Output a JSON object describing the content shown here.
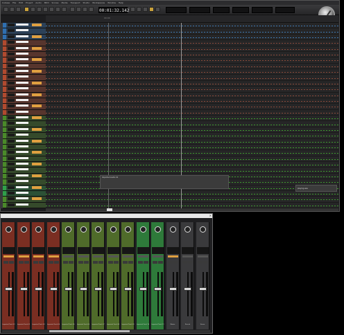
{
  "app": {
    "menu": [
      "Cubase",
      "File",
      "Edit",
      "Project",
      "Audio",
      "MIDI",
      "Scores",
      "Media",
      "Transport",
      "Studio",
      "Workspaces",
      "Window",
      "Help"
    ]
  },
  "transport": {
    "time": "00:01:32.142",
    "time_sub": ""
  },
  "ruler": {
    "marker": "00:00"
  },
  "tracks": [
    {
      "color": "#2f6fb0"
    },
    {
      "color": "#2f6fb0"
    },
    {
      "color": "#2f6fb0"
    },
    {
      "color": "#b04a2f"
    },
    {
      "color": "#b04a2f"
    },
    {
      "color": "#b04a2f"
    },
    {
      "color": "#b04a2f"
    },
    {
      "color": "#b04a2f"
    },
    {
      "color": "#b04a2f"
    },
    {
      "color": "#b04a2f"
    },
    {
      "color": "#b04a2f"
    },
    {
      "color": "#b04a2f"
    },
    {
      "color": "#b04a2f"
    },
    {
      "color": "#b04a2f"
    },
    {
      "color": "#b04a2f"
    },
    {
      "color": "#b04a2f"
    },
    {
      "color": "#4a8a2a"
    },
    {
      "color": "#4a8a2a"
    },
    {
      "color": "#4a8a2a"
    },
    {
      "color": "#4a8a2a"
    },
    {
      "color": "#4a8a2a"
    },
    {
      "color": "#4a8a2a"
    },
    {
      "color": "#4a8a2a"
    },
    {
      "color": "#4a8a2a"
    },
    {
      "color": "#4a8a2a"
    },
    {
      "color": "#4a8a2a"
    },
    {
      "color": "#4a8a2a"
    },
    {
      "color": "#4a8a2a"
    },
    {
      "color": "#2fa04a"
    },
    {
      "color": "#2fa04a"
    },
    {
      "color": "#4a8a2a"
    },
    {
      "color": "#4a8a2a"
    }
  ],
  "clips": [
    {
      "label": "Imported Audio 01"
    },
    {
      "label": "playing.wav"
    }
  ],
  "mixer": {
    "strips": [
      {
        "color": "#7a2e22",
        "label": "Imported Track 01",
        "pan_active": true
      },
      {
        "color": "#7a2e22",
        "label": "Imported Track 02",
        "pan_active": true
      },
      {
        "color": "#7a2e22",
        "label": "Imported Track 03",
        "pan_active": true
      },
      {
        "color": "#7a2e22",
        "label": "Imported Track 04",
        "pan_active": true
      },
      {
        "color": "#4f6b2a",
        "label": "Imported Track 05",
        "pan_active": false
      },
      {
        "color": "#4f6b2a",
        "label": "Imported Track 06",
        "pan_active": false
      },
      {
        "color": "#4f6b2a",
        "label": "Imported Track 07",
        "pan_active": false
      },
      {
        "color": "#4f6b2a",
        "label": "Imported Track 08",
        "pan_active": false
      },
      {
        "color": "#4f6b2a",
        "label": "Imported Track 09",
        "pan_active": false
      },
      {
        "color": "#2e7a3a",
        "label": "Imported Track 10",
        "pan_active": false
      },
      {
        "color": "#2e7a3a",
        "label": "Imported Track 11",
        "pan_active": false
      },
      {
        "color": "#3a3a3c",
        "label": "Master",
        "pan_active": true
      },
      {
        "color": "#3a3a3c",
        "label": "Reverb",
        "pan_active": false
      },
      {
        "color": "#3a3a3c",
        "label": "Stereo",
        "pan_active": false
      }
    ]
  }
}
